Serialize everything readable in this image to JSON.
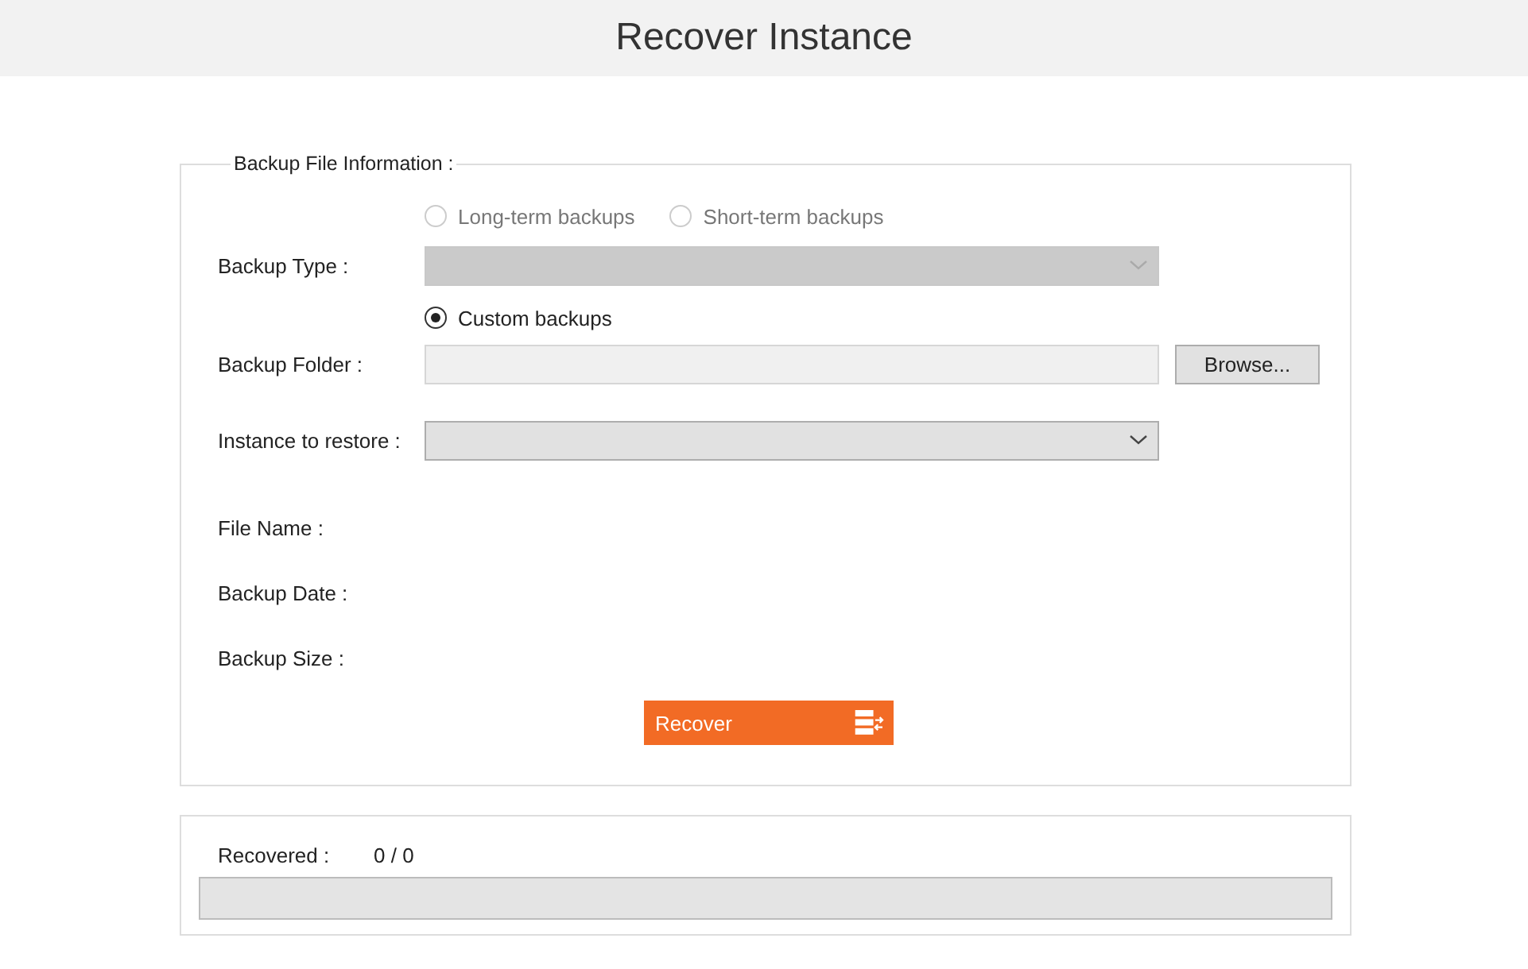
{
  "title": "Recover Instance",
  "backup_info": {
    "legend": "Backup File Information :",
    "backup_type_options": [
      {
        "label": "Long-term backups",
        "selected": false,
        "disabled": true
      },
      {
        "label": "Short-term backups",
        "selected": false,
        "disabled": true
      }
    ],
    "backup_type": {
      "label": "Backup Type :",
      "disabled": true
    },
    "custom_option": {
      "label": "Custom backups",
      "selected": true,
      "disabled": false
    },
    "backup_folder": {
      "label": "Backup Folder :",
      "button": "Browse..."
    },
    "instance": {
      "label": "Instance to restore :",
      "disabled": false
    },
    "details": [
      {
        "label": "File Name :"
      },
      {
        "label": "Backup Date :"
      },
      {
        "label": "Backup Size :"
      }
    ],
    "recover_button": "Recover"
  },
  "progress": {
    "label": "Recovered :",
    "value": "0 / 0",
    "level": 0
  }
}
